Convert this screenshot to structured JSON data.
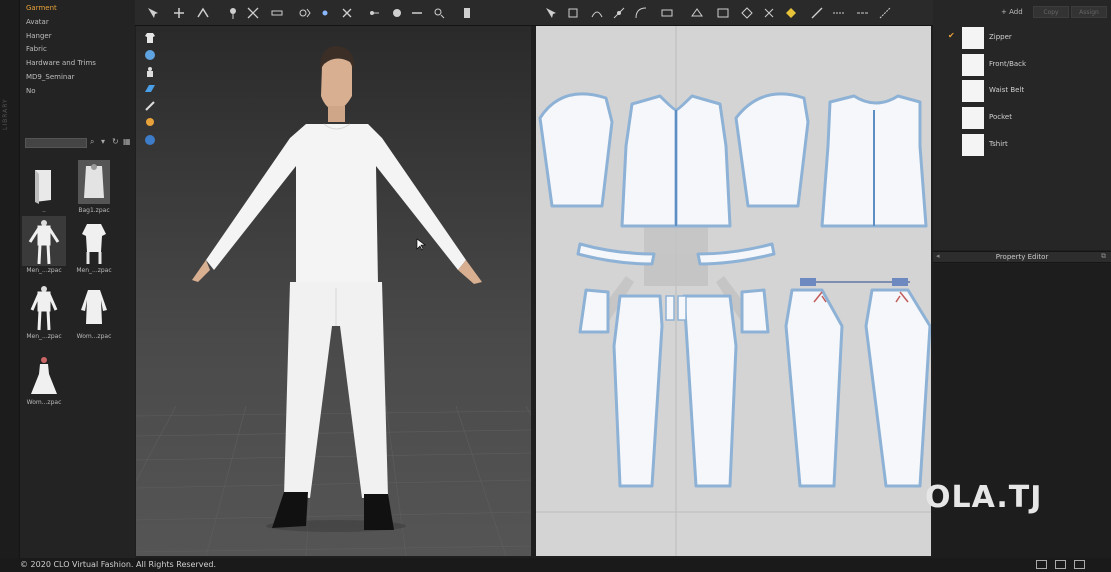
{
  "library": {
    "side_label": "LIBRARY",
    "folders": [
      {
        "label": "Garment",
        "active": true
      },
      {
        "label": "Avatar",
        "active": false
      },
      {
        "label": "Hanger",
        "active": false
      },
      {
        "label": "Fabric",
        "active": false
      },
      {
        "label": "Hardware and Trims",
        "active": false
      },
      {
        "label": "MD9_Seminar",
        "active": false
      },
      {
        "label": "No",
        "active": false
      }
    ],
    "files": [
      {
        "name": "..",
        "icon": "folder-up-icon"
      },
      {
        "name": "Bag1.zpac",
        "icon": "bag-thumbnail"
      },
      {
        "name": "Men_...zpac",
        "icon": "men-outfit-thumbnail"
      },
      {
        "name": "Men_...zpac",
        "icon": "men-shirt-thumbnail"
      },
      {
        "name": "Men_...zpac",
        "icon": "men-suit-thumbnail"
      },
      {
        "name": "Wom...zpac",
        "icon": "women-outfit-thumbnail"
      },
      {
        "name": "Wom...zpac",
        "icon": "women-dress-thumbnail"
      }
    ]
  },
  "object_browser": {
    "add_label": "+ Add",
    "copy_label": "Copy",
    "assign_label": "Assign",
    "fabrics": [
      {
        "label": "Zipper",
        "checked": true
      },
      {
        "label": "Front/Back",
        "checked": false
      },
      {
        "label": "Waist Belt",
        "checked": false
      },
      {
        "label": "Pocket",
        "checked": false
      },
      {
        "label": "Tshirt",
        "checked": false
      }
    ]
  },
  "property_editor": {
    "title": "Property Editor"
  },
  "status": {
    "copyright": "© 2020 CLO Virtual Fashion. All Rights Reserved."
  },
  "watermark": "OLA.TJ",
  "colors": {
    "accent": "#e8a23a",
    "pattern_fill": "#f5f7fa",
    "pattern_outline": "#8eb2d6",
    "pattern_bg": "#d4d4d4"
  }
}
